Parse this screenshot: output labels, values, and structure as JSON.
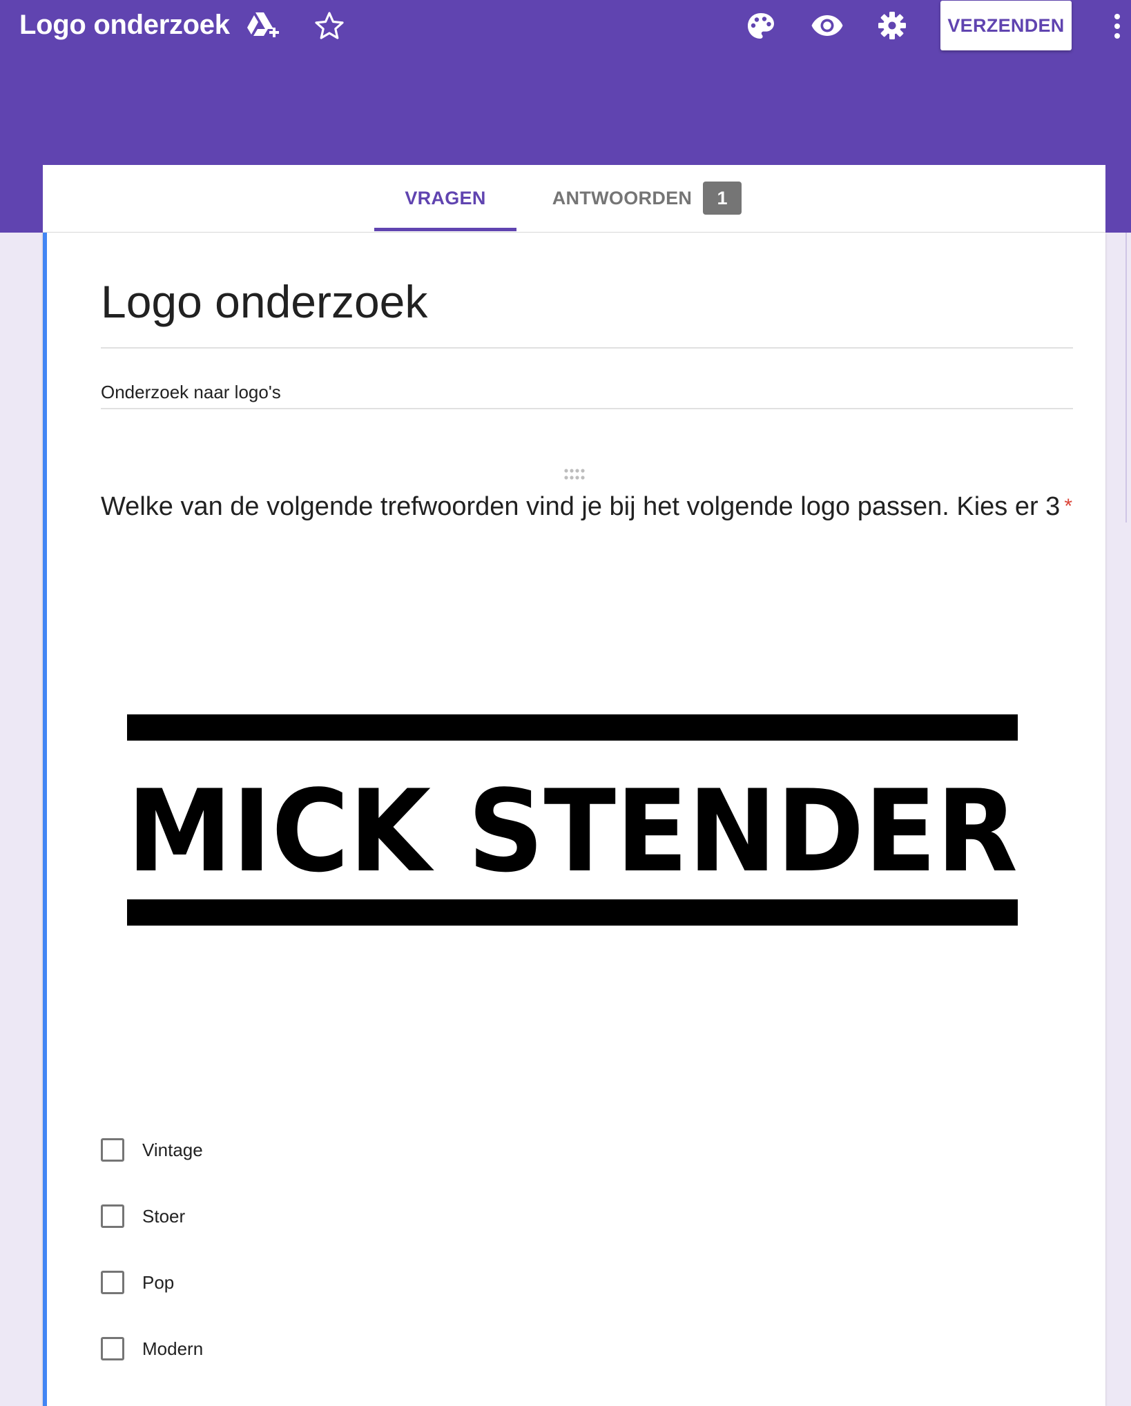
{
  "header": {
    "title": "Logo onderzoek",
    "icons": [
      "drive-add-icon",
      "star-icon",
      "palette-icon",
      "eye-icon",
      "gear-icon",
      "more-vert-icon"
    ],
    "send_label": "VERZENDEN",
    "colors": {
      "primary": "#6044b0",
      "white": "#ffffff"
    }
  },
  "tabs": {
    "questions_label": "VRAGEN",
    "answers_label": "ANTWOORDEN",
    "answers_count": "1",
    "active": "questions"
  },
  "form": {
    "title": "Logo onderzoek",
    "description": "Onderzoek naar logo's",
    "accent_color": "#4285f4"
  },
  "question": {
    "text": "Welke van de volgende trefwoorden vind je bij het volgende logo passen. Kies er 3",
    "required_mark": "*",
    "image_text": "MICK STENDER",
    "options": [
      "Vintage",
      "Stoer",
      "Pop",
      "Modern"
    ]
  }
}
